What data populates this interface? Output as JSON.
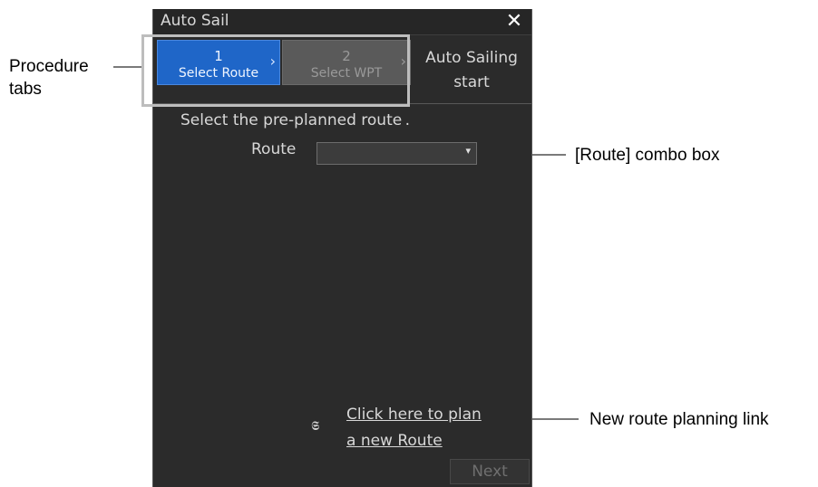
{
  "annotations": {
    "procedure_tabs": [
      "Procedure",
      "tabs"
    ],
    "route_combo": "[Route] combo box",
    "new_route_link": "New route planning link"
  },
  "dialog": {
    "title": "Auto Sail",
    "close_icon": "close-icon",
    "tabs": [
      {
        "number": "1",
        "label": "Select Route",
        "state": "active"
      },
      {
        "number": "2",
        "label": "Select WPT",
        "state": "disabled"
      }
    ],
    "step3": [
      "Auto Sailing",
      "start"
    ],
    "instruction": "Select the pre-planned route .",
    "route": {
      "label": "Route",
      "value": ""
    },
    "plan_icon": "route-plan-icon",
    "plan_link": [
      "Click here to plan",
      "a new Route"
    ],
    "next_label": "Next"
  },
  "colors": {
    "active_tab": "#1f66c8",
    "inactive_tab": "#5a5a5a",
    "panel_bg": "#2b2b2b"
  }
}
